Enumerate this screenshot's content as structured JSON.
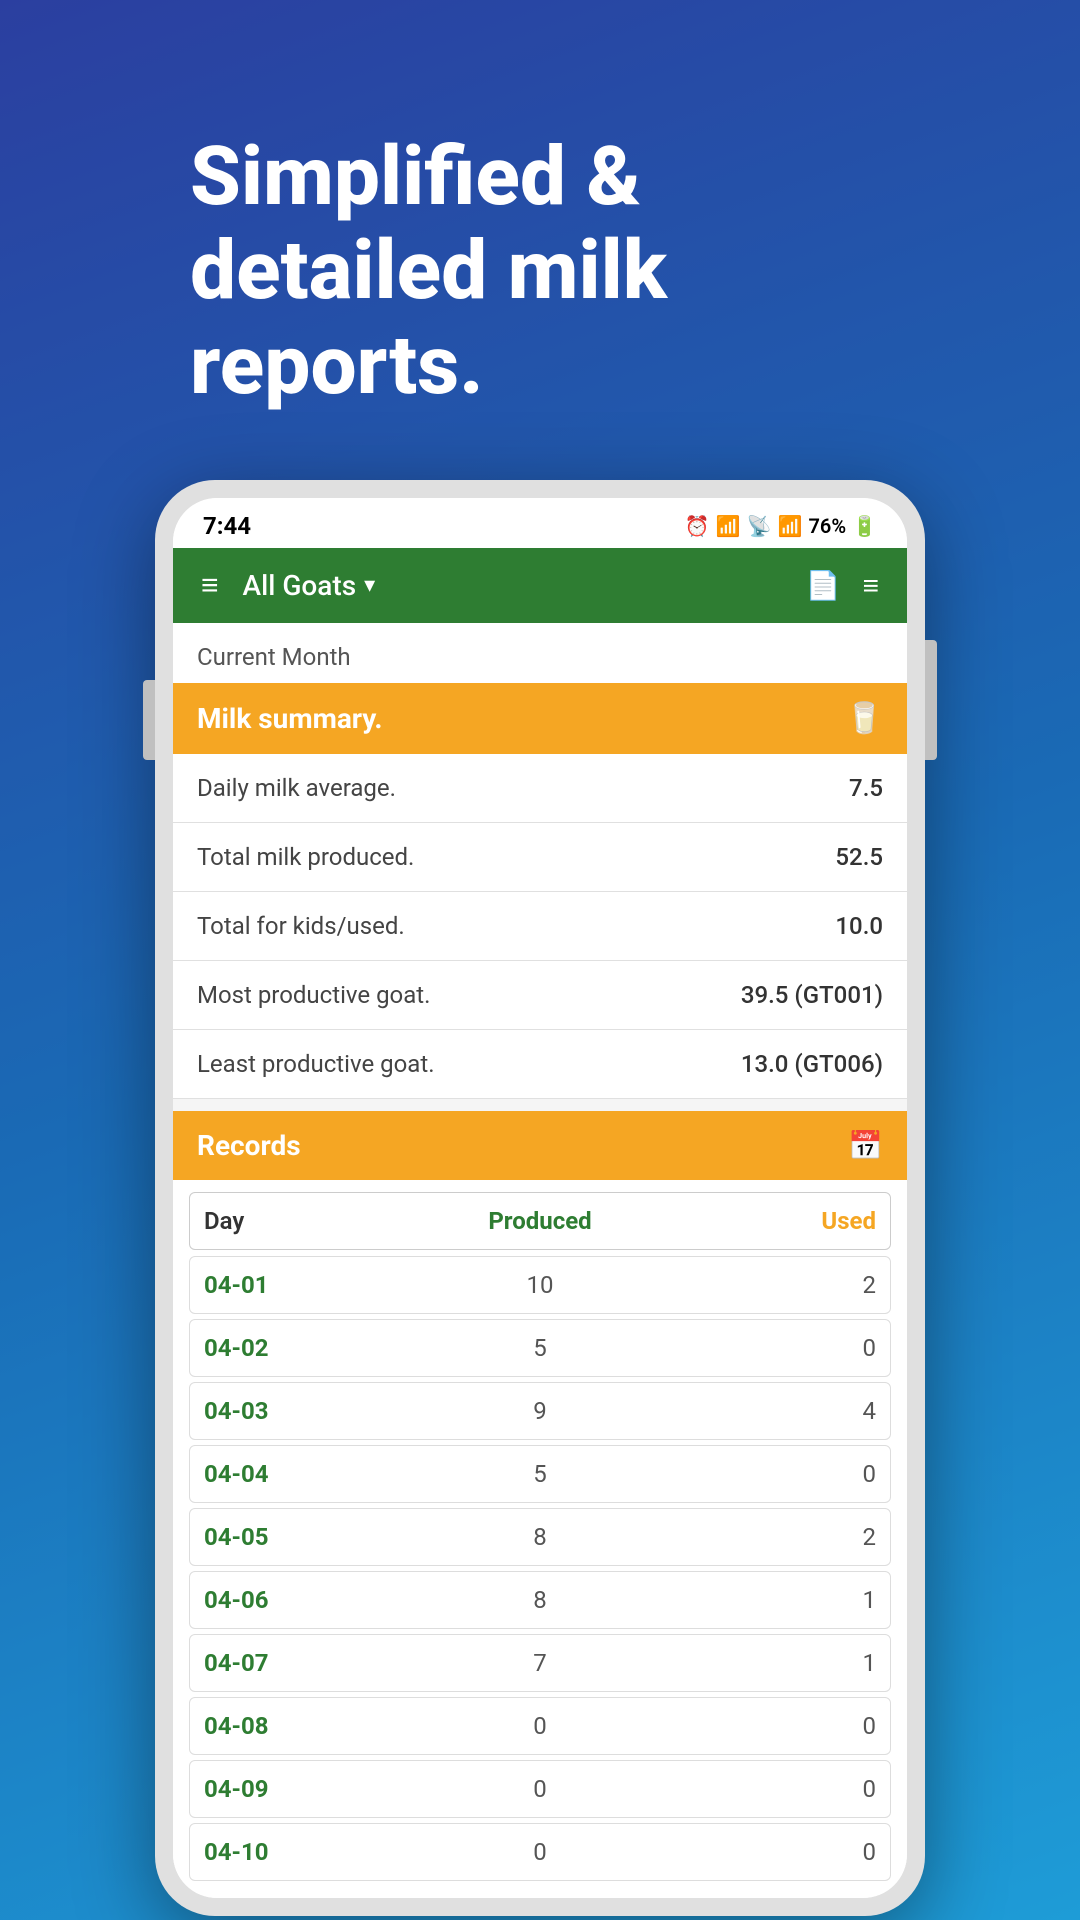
{
  "hero": {
    "line1": "Simplified &",
    "line2": "detailed milk",
    "line3": "reports."
  },
  "status_bar": {
    "time": "7:44",
    "battery": "76%",
    "battery_icon": "🔋"
  },
  "app_bar": {
    "menu_icon": "≡",
    "title": "All Goats",
    "dropdown_icon": "▾",
    "pdf_icon": "📄",
    "filter_icon": "≡"
  },
  "section_label": "Current Month",
  "summary": {
    "header": "Milk summary.",
    "header_icon": "🥛",
    "rows": [
      {
        "label": "Daily milk average.",
        "value": "7.5"
      },
      {
        "label": "Total milk produced.",
        "value": "52.5"
      },
      {
        "label": "Total for kids/used.",
        "value": "10.0"
      },
      {
        "label": "Most productive goat.",
        "value": "39.5 (GT001)"
      },
      {
        "label": "Least productive goat.",
        "value": "13.0 (GT006)"
      }
    ]
  },
  "records": {
    "header": "Records",
    "header_icon": "📅",
    "table_headers": {
      "day": "Day",
      "produced": "Produced",
      "used": "Used"
    },
    "rows": [
      {
        "day": "04-01",
        "produced": "10",
        "used": "2"
      },
      {
        "day": "04-02",
        "produced": "5",
        "used": "0"
      },
      {
        "day": "04-03",
        "produced": "9",
        "used": "4"
      },
      {
        "day": "04-04",
        "produced": "5",
        "used": "0"
      },
      {
        "day": "04-05",
        "produced": "8",
        "used": "2"
      },
      {
        "day": "04-06",
        "produced": "8",
        "used": "1"
      },
      {
        "day": "04-07",
        "produced": "7",
        "used": "1"
      },
      {
        "day": "04-08",
        "produced": "0",
        "used": "0"
      },
      {
        "day": "04-09",
        "produced": "0",
        "used": "0"
      },
      {
        "day": "04-10",
        "produced": "0",
        "used": "0"
      }
    ]
  },
  "colors": {
    "green": "#2e7d32",
    "orange": "#f5a623",
    "background_gradient_top": "#2b3fa0",
    "background_gradient_bottom": "#1e9cd7"
  }
}
